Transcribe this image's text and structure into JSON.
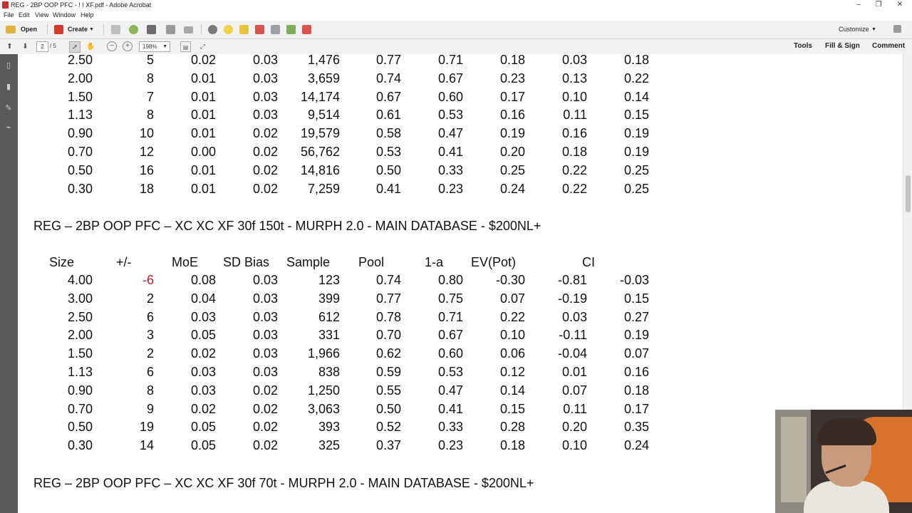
{
  "window": {
    "title": "REG - 2BP OOP PFC - ! ! XF.pdf - Adobe Acrobat",
    "controls": [
      "–",
      "❐",
      "✕"
    ]
  },
  "menu": [
    "File",
    "Edit",
    "View",
    "Window",
    "Help"
  ],
  "toolbar": {
    "open_label": "Open",
    "create_label": "Create",
    "customize_label": "Customize"
  },
  "nav": {
    "page_current": "2",
    "page_total": "/ 5",
    "zoom": "198%",
    "tools_label": "Tools",
    "fill_sign_label": "Fill & Sign",
    "comment_label": "Comment"
  },
  "doc": {
    "top_table_rows": [
      [
        "2.50",
        "5",
        "0.02",
        "0.03",
        "1,476",
        "0.77",
        "0.71",
        "0.18",
        "0.03",
        "0.18"
      ],
      [
        "2.00",
        "8",
        "0.01",
        "0.03",
        "3,659",
        "0.74",
        "0.67",
        "0.23",
        "0.13",
        "0.22"
      ],
      [
        "1.50",
        "7",
        "0.01",
        "0.03",
        "14,174",
        "0.67",
        "0.60",
        "0.17",
        "0.10",
        "0.14"
      ],
      [
        "1.13",
        "8",
        "0.01",
        "0.03",
        "9,514",
        "0.61",
        "0.53",
        "0.16",
        "0.11",
        "0.15"
      ],
      [
        "0.90",
        "10",
        "0.01",
        "0.02",
        "19,579",
        "0.58",
        "0.47",
        "0.19",
        "0.16",
        "0.19"
      ],
      [
        "0.70",
        "12",
        "0.00",
        "0.02",
        "56,762",
        "0.53",
        "0.41",
        "0.20",
        "0.18",
        "0.19"
      ],
      [
        "0.50",
        "16",
        "0.01",
        "0.02",
        "14,816",
        "0.50",
        "0.33",
        "0.25",
        "0.22",
        "0.25"
      ],
      [
        "0.30",
        "18",
        "0.01",
        "0.02",
        "7,259",
        "0.41",
        "0.23",
        "0.24",
        "0.22",
        "0.25"
      ]
    ],
    "heading1": "REG – 2BP OOP PFC – XC XC XF 30f 150t - MURPH 2.0 - MAIN DATABASE - $200NL+",
    "columns": [
      "Size",
      "+/-",
      "MoE",
      "SD Bias",
      "Sample",
      "Pool",
      "1-a",
      "EV(Pot)",
      "CI"
    ],
    "table_rows": [
      [
        "4.00",
        "-6",
        "0.08",
        "0.03",
        "123",
        "0.74",
        "0.80",
        "-0.30",
        "-0.81",
        "-0.03"
      ],
      [
        "3.00",
        "2",
        "0.04",
        "0.03",
        "399",
        "0.77",
        "0.75",
        "0.07",
        "-0.19",
        "0.15"
      ],
      [
        "2.50",
        "6",
        "0.03",
        "0.03",
        "612",
        "0.78",
        "0.71",
        "0.22",
        "0.03",
        "0.27"
      ],
      [
        "2.00",
        "3",
        "0.05",
        "0.03",
        "331",
        "0.70",
        "0.67",
        "0.10",
        "-0.11",
        "0.19"
      ],
      [
        "1.50",
        "2",
        "0.02",
        "0.03",
        "1,966",
        "0.62",
        "0.60",
        "0.06",
        "-0.04",
        "0.07"
      ],
      [
        "1.13",
        "6",
        "0.03",
        "0.03",
        "838",
        "0.59",
        "0.53",
        "0.12",
        "0.01",
        "0.16"
      ],
      [
        "0.90",
        "8",
        "0.03",
        "0.02",
        "1,250",
        "0.55",
        "0.47",
        "0.14",
        "0.07",
        "0.18"
      ],
      [
        "0.70",
        "9",
        "0.02",
        "0.02",
        "3,063",
        "0.50",
        "0.41",
        "0.15",
        "0.11",
        "0.17"
      ],
      [
        "0.50",
        "19",
        "0.05",
        "0.02",
        "393",
        "0.52",
        "0.33",
        "0.28",
        "0.20",
        "0.35"
      ],
      [
        "0.30",
        "14",
        "0.05",
        "0.02",
        "325",
        "0.37",
        "0.23",
        "0.18",
        "0.10",
        "0.24"
      ]
    ],
    "heading2": "REG – 2BP OOP PFC – XC XC XF 30f 70t - MURPH 2.0 - MAIN DATABASE - $200NL+",
    "negative_color": "#cc1f1f"
  }
}
